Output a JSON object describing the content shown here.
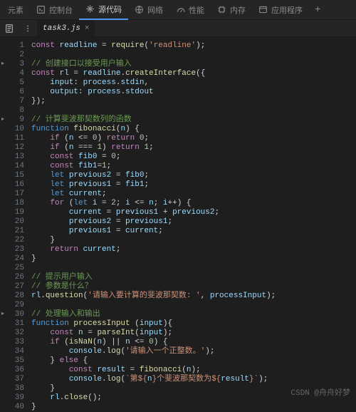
{
  "topbar": {
    "items": [
      {
        "label": "元素"
      },
      {
        "label": "控制台"
      },
      {
        "label": "源代码"
      },
      {
        "label": "网络"
      },
      {
        "label": "性能"
      },
      {
        "label": "内存"
      },
      {
        "label": "应用程序"
      }
    ],
    "active_index": 2
  },
  "tab": {
    "filename": "task3.js"
  },
  "code": {
    "lines": [
      {
        "n": 1,
        "ind": 0,
        "seg": [
          [
            "kw",
            "const"
          ],
          [
            "op",
            " "
          ],
          [
            "id",
            "readline"
          ],
          [
            "op",
            " = "
          ],
          [
            "fn",
            "require"
          ],
          [
            "op",
            "("
          ],
          [
            "str",
            "'readline'"
          ],
          [
            "op",
            ");"
          ]
        ]
      },
      {
        "n": 2,
        "ind": 0,
        "seg": []
      },
      {
        "n": 3,
        "ind": 0,
        "fold": true,
        "seg": [
          [
            "cmt",
            "// 创建接口以接受用户输入"
          ]
        ]
      },
      {
        "n": 4,
        "ind": 0,
        "seg": [
          [
            "kw",
            "const"
          ],
          [
            "op",
            " "
          ],
          [
            "id",
            "rl"
          ],
          [
            "op",
            " = "
          ],
          [
            "id",
            "readline"
          ],
          [
            "op",
            "."
          ],
          [
            "fn",
            "createInterface"
          ],
          [
            "op",
            "({"
          ]
        ]
      },
      {
        "n": 5,
        "ind": 1,
        "seg": [
          [
            "id",
            "input"
          ],
          [
            "op",
            ": "
          ],
          [
            "id",
            "process"
          ],
          [
            "op",
            "."
          ],
          [
            "id",
            "stdin"
          ],
          [
            "op",
            ","
          ]
        ]
      },
      {
        "n": 6,
        "ind": 1,
        "seg": [
          [
            "id",
            "output"
          ],
          [
            "op",
            ": "
          ],
          [
            "id",
            "process"
          ],
          [
            "op",
            "."
          ],
          [
            "id",
            "stdout"
          ]
        ]
      },
      {
        "n": 7,
        "ind": 0,
        "seg": [
          [
            "op",
            "});"
          ]
        ]
      },
      {
        "n": 8,
        "ind": 0,
        "seg": []
      },
      {
        "n": 9,
        "ind": 0,
        "fold": true,
        "seg": [
          [
            "cmt",
            "// 计算斐波那契数列的函数"
          ]
        ]
      },
      {
        "n": 10,
        "ind": 0,
        "seg": [
          [
            "kw2",
            "function"
          ],
          [
            "op",
            " "
          ],
          [
            "fn",
            "fibonacci"
          ],
          [
            "op",
            "("
          ],
          [
            "id",
            "n"
          ],
          [
            "op",
            ") {"
          ]
        ]
      },
      {
        "n": 11,
        "ind": 1,
        "seg": [
          [
            "kw",
            "if"
          ],
          [
            "op",
            " ("
          ],
          [
            "id",
            "n"
          ],
          [
            "op",
            " <= "
          ],
          [
            "num",
            "0"
          ],
          [
            "op",
            ") "
          ],
          [
            "kw",
            "return"
          ],
          [
            "op",
            " "
          ],
          [
            "num",
            "0"
          ],
          [
            "op",
            ";"
          ]
        ]
      },
      {
        "n": 12,
        "ind": 1,
        "seg": [
          [
            "kw",
            "if"
          ],
          [
            "op",
            " ("
          ],
          [
            "id",
            "n"
          ],
          [
            "op",
            " === "
          ],
          [
            "num",
            "1"
          ],
          [
            "op",
            ") "
          ],
          [
            "kw",
            "return"
          ],
          [
            "op",
            " "
          ],
          [
            "num",
            "1"
          ],
          [
            "op",
            ";"
          ]
        ]
      },
      {
        "n": 13,
        "ind": 1,
        "seg": [
          [
            "kw",
            "const"
          ],
          [
            "op",
            " "
          ],
          [
            "id",
            "fib0"
          ],
          [
            "op",
            " = "
          ],
          [
            "num",
            "0"
          ],
          [
            "op",
            ";"
          ]
        ]
      },
      {
        "n": 14,
        "ind": 1,
        "seg": [
          [
            "kw",
            "const"
          ],
          [
            "op",
            " "
          ],
          [
            "id",
            "fib1"
          ],
          [
            "op",
            "="
          ],
          [
            "num",
            "1"
          ],
          [
            "op",
            ";"
          ]
        ]
      },
      {
        "n": 15,
        "ind": 1,
        "seg": [
          [
            "kw2",
            "let"
          ],
          [
            "op",
            " "
          ],
          [
            "id",
            "previous2"
          ],
          [
            "op",
            " = "
          ],
          [
            "id",
            "fib0"
          ],
          [
            "op",
            ";"
          ]
        ]
      },
      {
        "n": 16,
        "ind": 1,
        "seg": [
          [
            "kw2",
            "let"
          ],
          [
            "op",
            " "
          ],
          [
            "id",
            "previous1"
          ],
          [
            "op",
            " = "
          ],
          [
            "id",
            "fib1"
          ],
          [
            "op",
            ";"
          ]
        ]
      },
      {
        "n": 17,
        "ind": 1,
        "seg": [
          [
            "kw2",
            "let"
          ],
          [
            "op",
            " "
          ],
          [
            "id",
            "current"
          ],
          [
            "op",
            ";"
          ]
        ]
      },
      {
        "n": 18,
        "ind": 1,
        "seg": [
          [
            "kw",
            "for"
          ],
          [
            "op",
            " ("
          ],
          [
            "kw2",
            "let"
          ],
          [
            "op",
            " "
          ],
          [
            "id",
            "i"
          ],
          [
            "op",
            " = "
          ],
          [
            "num",
            "2"
          ],
          [
            "op",
            "; "
          ],
          [
            "id",
            "i"
          ],
          [
            "op",
            " <= "
          ],
          [
            "id",
            "n"
          ],
          [
            "op",
            "; "
          ],
          [
            "id",
            "i"
          ],
          [
            "op",
            "++) {"
          ]
        ]
      },
      {
        "n": 19,
        "ind": 2,
        "seg": [
          [
            "id",
            "current"
          ],
          [
            "op",
            " = "
          ],
          [
            "id",
            "previous1"
          ],
          [
            "op",
            " + "
          ],
          [
            "id",
            "previous2"
          ],
          [
            "op",
            ";"
          ]
        ]
      },
      {
        "n": 20,
        "ind": 2,
        "seg": [
          [
            "id",
            "previous2"
          ],
          [
            "op",
            " = "
          ],
          [
            "id",
            "previous1"
          ],
          [
            "op",
            ";"
          ]
        ]
      },
      {
        "n": 21,
        "ind": 2,
        "seg": [
          [
            "id",
            "previous1"
          ],
          [
            "op",
            " = "
          ],
          [
            "id",
            "current"
          ],
          [
            "op",
            ";"
          ]
        ]
      },
      {
        "n": 22,
        "ind": 1,
        "seg": [
          [
            "op",
            "}"
          ]
        ]
      },
      {
        "n": 23,
        "ind": 1,
        "seg": [
          [
            "kw",
            "return"
          ],
          [
            "op",
            " "
          ],
          [
            "id",
            "current"
          ],
          [
            "op",
            ";"
          ]
        ]
      },
      {
        "n": 24,
        "ind": 0,
        "seg": [
          [
            "op",
            "}"
          ]
        ]
      },
      {
        "n": 25,
        "ind": 0,
        "seg": []
      },
      {
        "n": 26,
        "ind": 0,
        "seg": [
          [
            "cmt",
            "// 提示用户输入"
          ]
        ]
      },
      {
        "n": 27,
        "ind": 0,
        "seg": [
          [
            "cmt",
            "// 参数是什么？"
          ]
        ]
      },
      {
        "n": 28,
        "ind": 0,
        "seg": [
          [
            "id",
            "rl"
          ],
          [
            "op",
            "."
          ],
          [
            "fn",
            "question"
          ],
          [
            "op",
            "("
          ],
          [
            "str",
            "'请输入要计算的斐波那契数: '"
          ],
          [
            "op",
            ", "
          ],
          [
            "id",
            "processInput"
          ],
          [
            "op",
            ");"
          ]
        ]
      },
      {
        "n": 29,
        "ind": 0,
        "seg": []
      },
      {
        "n": 30,
        "ind": 0,
        "fold": true,
        "seg": [
          [
            "cmt",
            "// 处理输入和输出"
          ]
        ]
      },
      {
        "n": 31,
        "ind": 0,
        "seg": [
          [
            "kw2",
            "function"
          ],
          [
            "op",
            " "
          ],
          [
            "fn",
            "processInput"
          ],
          [
            "op",
            " ("
          ],
          [
            "id",
            "input"
          ],
          [
            "op",
            "){"
          ]
        ]
      },
      {
        "n": 32,
        "ind": 1,
        "seg": [
          [
            "kw",
            "const"
          ],
          [
            "op",
            " "
          ],
          [
            "id",
            "n"
          ],
          [
            "op",
            " = "
          ],
          [
            "fn",
            "parseInt"
          ],
          [
            "op",
            "("
          ],
          [
            "id",
            "input"
          ],
          [
            "op",
            ");"
          ]
        ]
      },
      {
        "n": 33,
        "ind": 1,
        "seg": [
          [
            "kw",
            "if"
          ],
          [
            "op",
            " ("
          ],
          [
            "fn",
            "isNaN"
          ],
          [
            "op",
            "("
          ],
          [
            "id",
            "n"
          ],
          [
            "op",
            ") || "
          ],
          [
            "id",
            "n"
          ],
          [
            "op",
            " <= "
          ],
          [
            "num",
            "0"
          ],
          [
            "op",
            ") {"
          ]
        ]
      },
      {
        "n": 34,
        "ind": 2,
        "seg": [
          [
            "id",
            "console"
          ],
          [
            "op",
            "."
          ],
          [
            "fn",
            "log"
          ],
          [
            "op",
            "("
          ],
          [
            "str",
            "'请输入一个正整数。'"
          ],
          [
            "op",
            ");"
          ]
        ]
      },
      {
        "n": 35,
        "ind": 1,
        "seg": [
          [
            "op",
            "} "
          ],
          [
            "kw",
            "else"
          ],
          [
            "op",
            " {"
          ]
        ]
      },
      {
        "n": 36,
        "ind": 2,
        "seg": [
          [
            "kw",
            "const"
          ],
          [
            "op",
            " "
          ],
          [
            "id",
            "result"
          ],
          [
            "op",
            " = "
          ],
          [
            "fn",
            "fibonacci"
          ],
          [
            "op",
            "("
          ],
          [
            "id",
            "n"
          ],
          [
            "op",
            ");"
          ]
        ]
      },
      {
        "n": 37,
        "ind": 2,
        "seg": [
          [
            "id",
            "console"
          ],
          [
            "op",
            "."
          ],
          [
            "fn",
            "log"
          ],
          [
            "op",
            "("
          ],
          [
            "str",
            "`第${"
          ],
          [
            "id",
            "n"
          ],
          [
            "str",
            "}个斐波那契数为${"
          ],
          [
            "id",
            "result"
          ],
          [
            "str",
            "}`"
          ],
          [
            "op",
            ");"
          ]
        ]
      },
      {
        "n": 38,
        "ind": 1,
        "seg": [
          [
            "op",
            "}"
          ]
        ]
      },
      {
        "n": 39,
        "ind": 1,
        "seg": [
          [
            "id",
            "rl"
          ],
          [
            "op",
            "."
          ],
          [
            "fn",
            "close"
          ],
          [
            "op",
            "();"
          ]
        ]
      },
      {
        "n": 40,
        "ind": 0,
        "seg": [
          [
            "op",
            "}"
          ]
        ]
      }
    ]
  },
  "watermark": "CSDN @舟舟好梦"
}
